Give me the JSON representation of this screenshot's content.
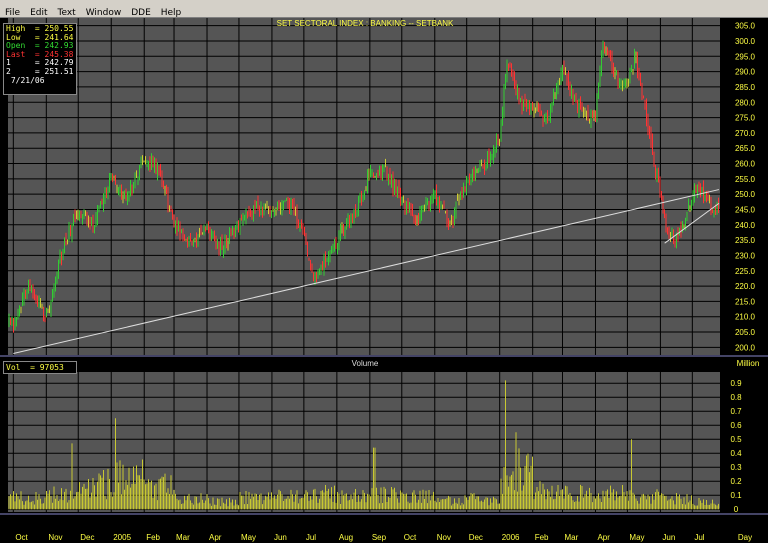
{
  "menu": [
    "File",
    "Edit",
    "Text",
    "Window",
    "DDE",
    "Help"
  ],
  "chart_title": "SET SECTORAL INDEX : BANKING -- SETBANK",
  "volume_title": "Volume",
  "volume_unit": "Million",
  "day_label": "Day",
  "legend": {
    "high_label": "High",
    "high_value": "250.55",
    "low_label": "Low",
    "low_value": "241.64",
    "open_label": "Open",
    "open_value": "242.93",
    "last_label": "Last",
    "last_value": "245.38",
    "line1_label": "1",
    "line1_value": "242.79",
    "line2_label": "2",
    "line2_value": "251.51",
    "date": "7/21/06",
    "vol_label": "Vol",
    "vol_value": "97053"
  },
  "colors": {
    "background": "#555555",
    "grid": "#000000",
    "up_bar": "#33cc33",
    "down_bar": "#ff3333",
    "neutral_bar": "#cccc33",
    "volume_bar": "#c8c832",
    "trendline": "#dddddd",
    "axis_text": "#ffff44"
  },
  "chart_data": [
    {
      "type": "line",
      "title": "SET SECTORAL INDEX : BANKING -- SETBANK",
      "style": "OHLC bars",
      "x_ticks": [
        "Oct",
        "Nov",
        "Dec",
        "2005",
        "Feb",
        "Mar",
        "Apr",
        "May",
        "Jun",
        "Jul",
        "Aug",
        "Sep",
        "Oct",
        "Nov",
        "Dec",
        "2006",
        "Feb",
        "Mar",
        "Apr",
        "May",
        "Jun",
        "Jul",
        "Day"
      ],
      "y_ticks": [
        200,
        205,
        210,
        215,
        220,
        225,
        230,
        235,
        240,
        245,
        250,
        255,
        260,
        265,
        270,
        275,
        280,
        285,
        290,
        295,
        300,
        305
      ],
      "ylim": [
        197.5,
        307.5
      ],
      "grid": true,
      "series": [
        {
          "values": [
            {
              "x": "2004-10-01",
              "y": 208
            },
            {
              "x": "2004-10-15",
              "y": 220
            },
            {
              "x": "2004-11-01",
              "y": 210
            },
            {
              "x": "2004-11-15",
              "y": 230
            },
            {
              "x": "2004-12-01",
              "y": 245
            },
            {
              "x": "2004-12-15",
              "y": 240
            },
            {
              "x": "2005-01-01",
              "y": 255
            },
            {
              "x": "2005-01-15",
              "y": 248
            },
            {
              "x": "2005-02-01",
              "y": 262
            },
            {
              "x": "2005-02-15",
              "y": 258
            },
            {
              "x": "2005-03-01",
              "y": 240
            },
            {
              "x": "2005-03-15",
              "y": 235
            },
            {
              "x": "2005-04-01",
              "y": 238
            },
            {
              "x": "2005-04-15",
              "y": 232
            },
            {
              "x": "2005-05-01",
              "y": 240
            },
            {
              "x": "2005-05-15",
              "y": 245
            },
            {
              "x": "2005-06-01",
              "y": 246
            },
            {
              "x": "2005-06-15",
              "y": 248
            },
            {
              "x": "2005-07-01",
              "y": 238
            },
            {
              "x": "2005-07-10",
              "y": 222
            },
            {
              "x": "2005-07-20",
              "y": 228
            },
            {
              "x": "2005-08-01",
              "y": 235
            },
            {
              "x": "2005-08-15",
              "y": 242
            },
            {
              "x": "2005-09-01",
              "y": 256
            },
            {
              "x": "2005-09-15",
              "y": 258
            },
            {
              "x": "2005-10-01",
              "y": 248
            },
            {
              "x": "2005-10-15",
              "y": 242
            },
            {
              "x": "2005-11-01",
              "y": 250
            },
            {
              "x": "2005-11-15",
              "y": 240
            },
            {
              "x": "2005-12-01",
              "y": 255
            },
            {
              "x": "2005-12-15",
              "y": 258
            },
            {
              "x": "2006-01-01",
              "y": 268
            },
            {
              "x": "2006-01-08",
              "y": 295
            },
            {
              "x": "2006-01-20",
              "y": 280
            },
            {
              "x": "2006-02-01",
              "y": 278
            },
            {
              "x": "2006-02-15",
              "y": 274
            },
            {
              "x": "2006-03-01",
              "y": 292
            },
            {
              "x": "2006-03-15",
              "y": 278
            },
            {
              "x": "2006-04-01",
              "y": 274
            },
            {
              "x": "2006-04-08",
              "y": 300
            },
            {
              "x": "2006-04-20",
              "y": 288
            },
            {
              "x": "2006-05-01",
              "y": 285
            },
            {
              "x": "2006-05-08",
              "y": 295
            },
            {
              "x": "2006-05-15",
              "y": 282
            },
            {
              "x": "2006-05-25",
              "y": 262
            },
            {
              "x": "2006-06-08",
              "y": 238
            },
            {
              "x": "2006-06-15",
              "y": 235
            },
            {
              "x": "2006-06-25",
              "y": 243
            },
            {
              "x": "2006-07-05",
              "y": 253
            },
            {
              "x": "2006-07-15",
              "y": 248
            },
            {
              "x": "2006-07-21",
              "y": 245
            }
          ]
        }
      ],
      "trendlines": [
        {
          "name": "1",
          "from": {
            "x": "2004-10-01",
            "y": 198
          },
          "to": {
            "x": "2006-07-26",
            "y": 251.5
          }
        },
        {
          "name": "2",
          "from": {
            "x": "2006-06-05",
            "y": 234
          },
          "to": {
            "x": "2006-07-26",
            "y": 247
          }
        }
      ]
    },
    {
      "type": "bar",
      "title": "Volume",
      "unit": "Million",
      "y_ticks": [
        0,
        0.1,
        0.2,
        0.3,
        0.4,
        0.5,
        0.6,
        0.7,
        0.8,
        0.9
      ],
      "ylim": [
        -0.02,
        0.98
      ],
      "values_by_month": [
        {
          "x": "2004-10",
          "y": 0.09
        },
        {
          "x": "2004-11",
          "y": 0.12
        },
        {
          "x": "2004-12",
          "y": 0.2
        },
        {
          "x": "2005-01",
          "y": 0.25
        },
        {
          "x": "2005-02",
          "y": 0.18
        },
        {
          "x": "2005-03",
          "y": 0.08
        },
        {
          "x": "2005-04",
          "y": 0.06
        },
        {
          "x": "2005-05",
          "y": 0.09
        },
        {
          "x": "2005-06",
          "y": 0.1
        },
        {
          "x": "2005-07",
          "y": 0.12
        },
        {
          "x": "2005-08",
          "y": 0.1
        },
        {
          "x": "2005-09",
          "y": 0.12
        },
        {
          "x": "2005-10",
          "y": 0.1
        },
        {
          "x": "2005-11",
          "y": 0.07
        },
        {
          "x": "2005-12",
          "y": 0.08
        },
        {
          "x": "2006-01",
          "y": 0.3
        },
        {
          "x": "2006-02",
          "y": 0.15
        },
        {
          "x": "2006-03",
          "y": 0.12
        },
        {
          "x": "2006-04",
          "y": 0.12
        },
        {
          "x": "2006-05",
          "y": 0.1
        },
        {
          "x": "2006-06",
          "y": 0.08
        },
        {
          "x": "2006-07",
          "y": 0.06
        }
      ],
      "peaks": [
        {
          "x": "2006-01-06",
          "y": 0.92
        },
        {
          "x": "2005-01-05",
          "y": 0.65
        },
        {
          "x": "2004-11-25",
          "y": 0.47
        },
        {
          "x": "2006-01-16",
          "y": 0.55
        },
        {
          "x": "2006-05-05",
          "y": 0.5
        },
        {
          "x": "2005-09-05",
          "y": 0.44
        }
      ]
    }
  ]
}
